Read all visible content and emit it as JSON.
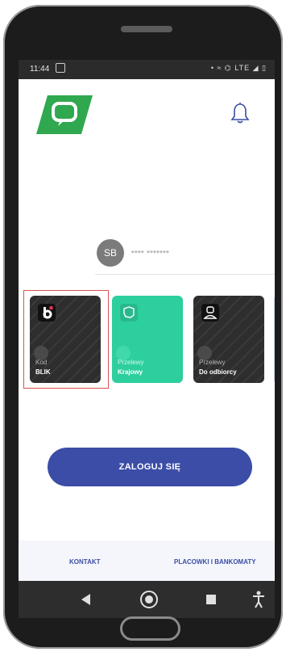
{
  "status_bar": {
    "time": "11:44",
    "icons": "• ≈ ⌬ LTE ◢ ▯"
  },
  "user": {
    "initials": "SB",
    "name": "•••• •••••••"
  },
  "tiles": [
    {
      "icon": "blik-icon",
      "subtitle": "Kod",
      "title": "BLIK"
    },
    {
      "icon": "poland-map-icon",
      "subtitle": "Przelewy",
      "title": "Krajowy"
    },
    {
      "icon": "person-icon",
      "subtitle": "Przelewy",
      "title": "Do odbiorcy"
    }
  ],
  "login_button": "ZALOGUJ SIĘ",
  "footer": {
    "contact": "KONTAKT",
    "branches": "PLACOWKI I BANKOMATY"
  },
  "colors": {
    "brand_green": "#2fa84f",
    "tile_green": "#2dcf9f",
    "primary_blue": "#3b4da6",
    "highlight": "#d9534f"
  }
}
